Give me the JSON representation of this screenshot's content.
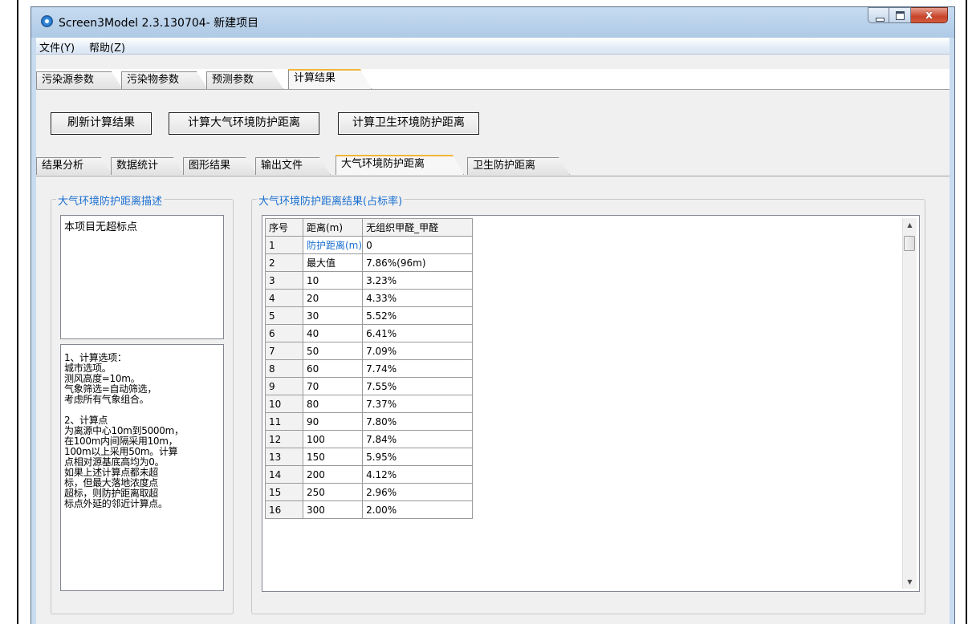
{
  "window": {
    "title": "Screen3Model 2.3.130704- 新建项目",
    "controls": {
      "minimize": "–",
      "maximize": "□",
      "close": "x"
    }
  },
  "menu": [
    "文件(Y)",
    "帮助(Z)"
  ],
  "main_tabs": [
    {
      "label": "污染源参数",
      "active": false
    },
    {
      "label": "污染物参数",
      "active": false
    },
    {
      "label": "预测参数",
      "active": false
    },
    {
      "label": "计算结果",
      "active": true
    }
  ],
  "toolbar": {
    "refresh": "刷新计算结果",
    "atmos_calc": "计算大气环境防护距离",
    "health_calc": "计算卫生环境防护距离"
  },
  "sub_tabs": [
    {
      "label": "结果分析",
      "active": false
    },
    {
      "label": "数据统计",
      "active": false
    },
    {
      "label": "图形结果",
      "active": false
    },
    {
      "label": "输出文件",
      "active": false
    },
    {
      "label": "大气环境防护距离",
      "active": true
    },
    {
      "label": "卫生防护距离",
      "active": false
    }
  ],
  "description_group": {
    "title": "大气环境防护距离描述",
    "summary": "本项目无超标点",
    "notes": "1、计算选项：\n城市选项。\n测风高度=10m。\n气象筛选=自动筛选，\n考虑所有气象组合。\n\n2、计算点\n为离源中心10m到5000m，\n在100m内间隔采用10m，\n100m以上采用50m。计算\n点相对源基底高均为0。\n如果上述计算点都未超\n标，但最大落地浓度点\n超标，则防护距离取超\n标点外延的邻近计算点。"
  },
  "results_group": {
    "title": "大气环境防护距离结果(占标率)",
    "columns": [
      "序号",
      "距离(m)",
      "无组织甲醛_甲醛"
    ],
    "rows": [
      [
        "1",
        "防护距离(m)",
        "0"
      ],
      [
        "2",
        "最大值",
        "7.86%(96m)"
      ],
      [
        "3",
        "10",
        "3.23%"
      ],
      [
        "4",
        "20",
        "4.33%"
      ],
      [
        "5",
        "30",
        "5.52%"
      ],
      [
        "6",
        "40",
        "6.41%"
      ],
      [
        "7",
        "50",
        "7.09%"
      ],
      [
        "8",
        "60",
        "7.74%"
      ],
      [
        "9",
        "70",
        "7.55%"
      ],
      [
        "10",
        "80",
        "7.37%"
      ],
      [
        "11",
        "90",
        "7.80%"
      ],
      [
        "12",
        "100",
        "7.84%"
      ],
      [
        "13",
        "150",
        "5.95%"
      ],
      [
        "14",
        "200",
        "4.12%"
      ],
      [
        "15",
        "250",
        "2.96%"
      ],
      [
        "16",
        "300",
        "2.00%"
      ]
    ]
  },
  "scrollbar": {
    "up_icon": "▲",
    "down_icon": "▼"
  }
}
